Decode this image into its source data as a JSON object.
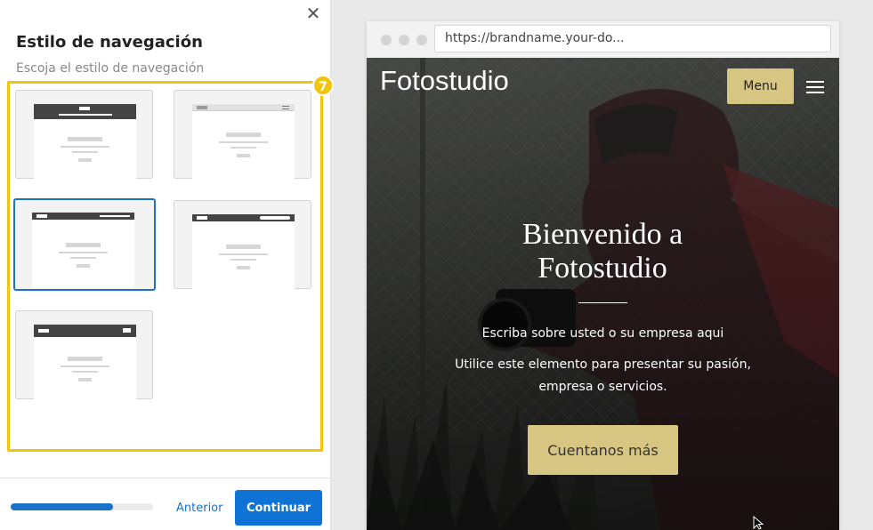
{
  "panel": {
    "title": "Estilo de navegación",
    "subtitle": "Escoja el estilo de navegación",
    "step_badge": "7",
    "close_icon": "close-icon",
    "options": [
      {
        "style": "centered-logo-links",
        "selected": false
      },
      {
        "style": "logo-left-hamburger",
        "selected": false
      },
      {
        "style": "logo-left-links-right",
        "selected": true
      },
      {
        "style": "logo-left-pill-right",
        "selected": false
      },
      {
        "style": "logo-left-menu-box",
        "selected": false
      }
    ],
    "accent_color": "#f1c40f",
    "selected_color": "#1a73c9"
  },
  "footer": {
    "progress_percent": 72,
    "prev_label": "Anterior",
    "continue_label": "Continuar"
  },
  "preview": {
    "url": "https://brandname.your-do...",
    "site_name": "Fotostudio",
    "menu_label": "Menu",
    "hero_title_line1": "Bienvenido a",
    "hero_title_line2": "Fotostudio",
    "hero_text1": "Escriba sobre usted o su empresa aqui",
    "hero_text2": "Utilice este elemento para presentar su pasión,",
    "hero_text3": "empresa o servicios.",
    "cta_label": "Cuentanos más",
    "button_color": "#d7c682"
  }
}
